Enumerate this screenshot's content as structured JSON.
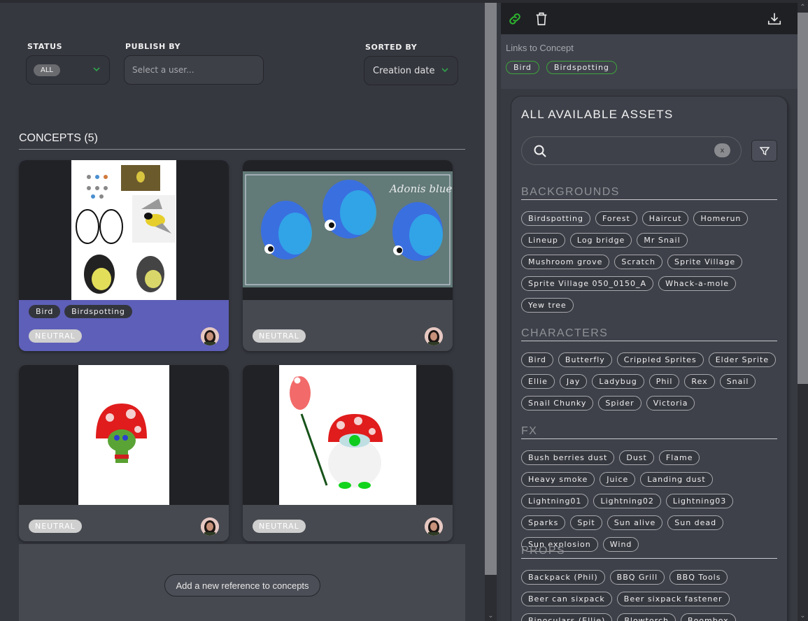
{
  "filters": {
    "status": {
      "label": "STATUS",
      "value": "ALL"
    },
    "publish_by": {
      "label": "PUBLISH BY",
      "placeholder": "Select a user..."
    },
    "sorted_by": {
      "label": "SORTED BY",
      "value": "Creation date"
    }
  },
  "concepts": {
    "title": "CONCEPTS (5)",
    "cards": [
      {
        "image": "british-tits-bird-sketches",
        "tags": [
          "Bird",
          "Birdspotting"
        ],
        "status": "NEUTRAL",
        "selected": true
      },
      {
        "image": "adonis-blue-butterflies",
        "tags": [],
        "status": "NEUTRAL",
        "selected": false
      },
      {
        "image": "mushroom-sprite-sketch",
        "tags": [],
        "status": "NEUTRAL",
        "selected": false
      },
      {
        "image": "mushroom-sprite-with-rose",
        "tags": [],
        "status": "NEUTRAL",
        "selected": false
      }
    ],
    "thumb_text": {
      "butterfly_title": "Adonis blue"
    },
    "add_button": "Add a new reference to concepts"
  },
  "toolbar": {
    "icons": [
      "link-icon",
      "trash-icon",
      "download-icon"
    ],
    "link_color": "#2eb82e"
  },
  "links": {
    "label": "Links to Concept",
    "tags": [
      "Bird",
      "Birdspotting"
    ]
  },
  "assets": {
    "title": "ALL AVAILABLE ASSETS",
    "search": {
      "value": "",
      "clear_label": "x"
    },
    "categories": [
      {
        "name": "BACKGROUNDS",
        "items": [
          "Birdspotting",
          "Forest",
          "Haircut",
          "Homerun",
          "Lineup",
          "Log bridge",
          "Mr Snail",
          "Mushroom grove",
          "Scratch",
          "Sprite Village",
          "Sprite Village 050_0150_A",
          "Whack-a-mole",
          "Yew tree"
        ]
      },
      {
        "name": "CHARACTERS",
        "items": [
          "Bird",
          "Butterfly",
          "Crippled Sprites",
          "Elder Sprite",
          "Ellie",
          "Jay",
          "Ladybug",
          "Phil",
          "Rex",
          "Snail",
          "Snail Chunky",
          "Spider",
          "Victoria"
        ]
      },
      {
        "name": "FX",
        "items": [
          "Bush berries dust",
          "Dust",
          "Flame",
          "Heavy smoke",
          "Juice",
          "Landing dust",
          "Lightning01",
          "Lightning02",
          "Lightning03",
          "Sparks",
          "Spit",
          "Sun alive",
          "Sun dead",
          "Sun explosion",
          "Wind"
        ]
      },
      {
        "name": "PROPS",
        "items": [
          "Backpack (Phil)",
          "BBQ Grill",
          "BBQ Tools",
          "Beer can sixpack",
          "Beer sixpack fastener",
          "Binoculars (Ellie)",
          "Blowtorch",
          "Boombox"
        ]
      }
    ]
  }
}
